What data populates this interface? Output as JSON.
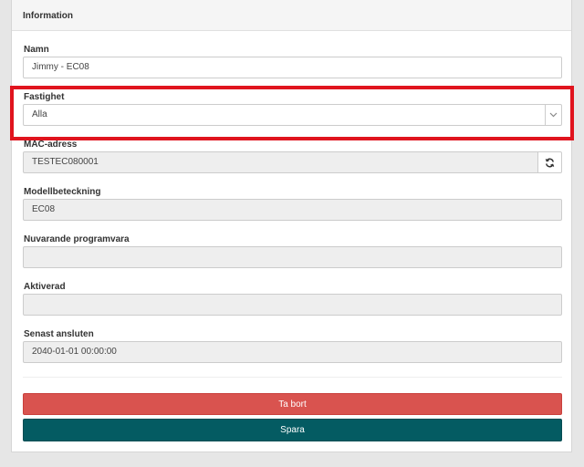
{
  "panel": {
    "title": "Information"
  },
  "form": {
    "name": {
      "label": "Namn",
      "value": "Jimmy - EC08"
    },
    "property": {
      "label": "Fastighet",
      "selected": "Alla"
    },
    "mac": {
      "label": "MAC-adress",
      "value": "TESTEC080001"
    },
    "model": {
      "label": "Modellbeteckning",
      "value": "EC08"
    },
    "firmware": {
      "label": "Nuvarande programvara",
      "value": ""
    },
    "activated": {
      "label": "Aktiverad",
      "value": ""
    },
    "last_connected": {
      "label": "Senast ansluten",
      "value": "2040-01-01 00:00:00"
    }
  },
  "actions": {
    "delete_label": "Ta bort",
    "save_label": "Spara"
  },
  "colors": {
    "delete": "#d9534f",
    "save": "#045b62",
    "highlight": "#e0141e"
  },
  "icons": {
    "select_arrow": "chevron-down-icon",
    "refresh": "refresh-icon"
  }
}
